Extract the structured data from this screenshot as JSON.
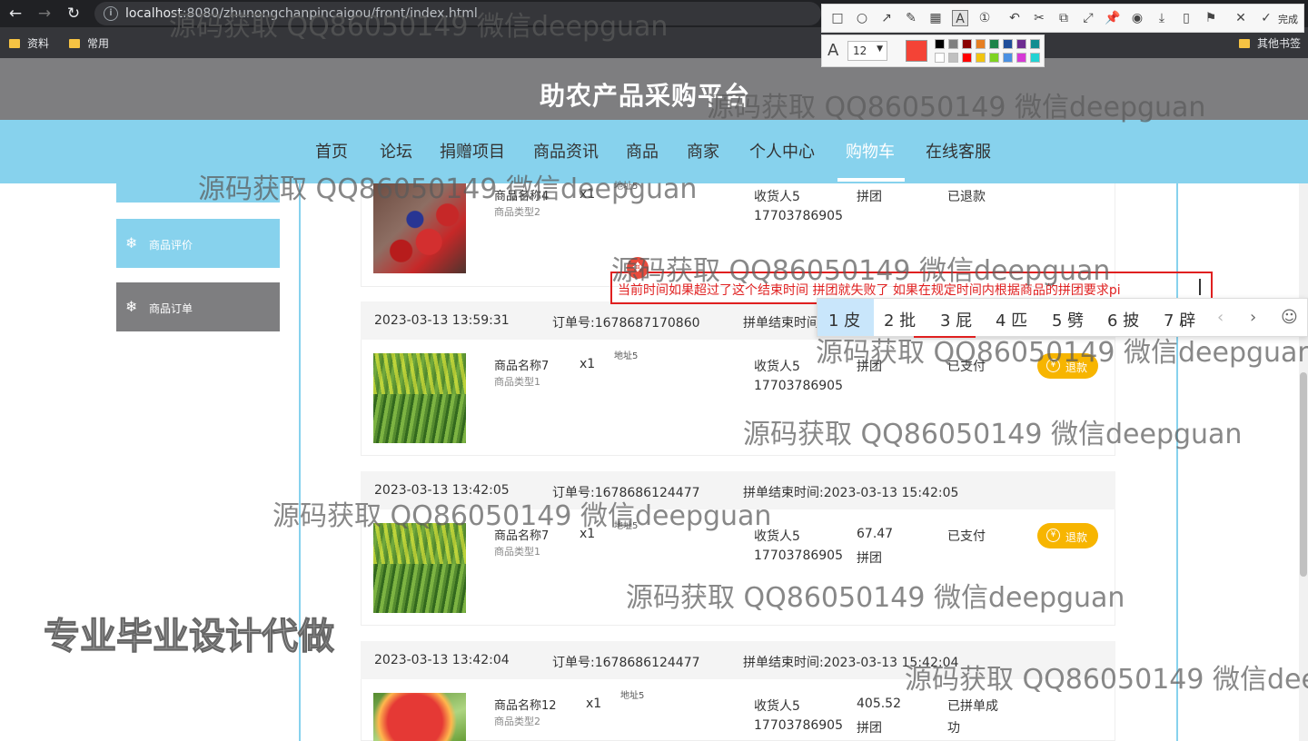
{
  "browser": {
    "url_host": "localhost",
    "url_path": ":8080/zhunongchanpincaigou/front/index.html",
    "bookmarks": [
      "资料",
      "常用"
    ],
    "other_bookmarks": "其他书签"
  },
  "site": {
    "title": "助农产品采购平台",
    "nav": [
      "首页",
      "论坛",
      "捐赠项目",
      "商品资讯",
      "商品",
      "商家",
      "个人中心",
      "购物车",
      "在线客服"
    ],
    "active_nav": "购物车"
  },
  "sidebar": {
    "items": [
      {
        "label": "商品评价",
        "color": "#87d2ed"
      },
      {
        "label": "商品订单",
        "color": "#7e7e80"
      }
    ]
  },
  "orders": [
    {
      "product_name": "商品名称4",
      "product_type": "商品类型2",
      "qty": "x1",
      "address": "地址5",
      "receiver": "收货人5",
      "phone": "17703786905",
      "type": "拼团",
      "status": "已退款"
    },
    {
      "time": "2023-03-13 13:59:31",
      "order_no": "订单号:1678687170860",
      "end_time": "拼单结束时间",
      "product_name": "商品名称7",
      "product_type": "商品类型1",
      "qty": "x1",
      "address": "地址5",
      "receiver": "收货人5",
      "phone": "17703786905",
      "type": "拼团",
      "status": "已支付",
      "action": "退款"
    },
    {
      "time": "2023-03-13 13:42:05",
      "order_no": "订单号:1678686124477",
      "end_time": "拼单结束时间:2023-03-13 15:42:05",
      "product_name": "商品名称7",
      "product_type": "商品类型1",
      "qty": "x1",
      "address": "地址5",
      "receiver": "收货人5",
      "phone": "17703786905",
      "price": "67.47",
      "type": "拼团",
      "status": "已支付",
      "action": "退款"
    },
    {
      "time": "2023-03-13 13:42:04",
      "order_no": "订单号:1678686124477",
      "end_time": "拼单结束时间:2023-03-13 15:42:04",
      "product_name": "商品名称12",
      "product_type": "商品类型2",
      "qty": "x1",
      "address": "地址5",
      "receiver": "收货人5",
      "phone": "17703786905",
      "price": "405.52",
      "type": "拼团",
      "status_1": "已拼单成",
      "status_2": "功"
    }
  ],
  "screenshot_tool": {
    "done_label": "完成",
    "font_size": "12",
    "current_color": "#f44336",
    "palette_row1": [
      "#000000",
      "#808080",
      "#8b0000",
      "#e67e22",
      "#1e8449",
      "#1f4e9a",
      "#6c2c91",
      "#138d90"
    ],
    "palette_row2": [
      "#ffffff",
      "#c0c0c0",
      "#ff0000",
      "#f1c40f",
      "#7ed321",
      "#4a90e2",
      "#d63ad6",
      "#22d3d3"
    ]
  },
  "annotation": {
    "text": "当前时间如果超过了这个结束时间 拼团就失败了  如果在规定时间内根据商品的拼团要求pi"
  },
  "ime": {
    "candidates": [
      "1 皮",
      "2 批",
      "3 屁",
      "4 匹",
      "5 劈",
      "6 披",
      "7 辟"
    ]
  },
  "watermarks": {
    "text": "源码获取 QQ86050149 微信deepguan",
    "partial": "源码获取 QQ86050149 微信dee",
    "big": "专业毕业设计代做"
  }
}
